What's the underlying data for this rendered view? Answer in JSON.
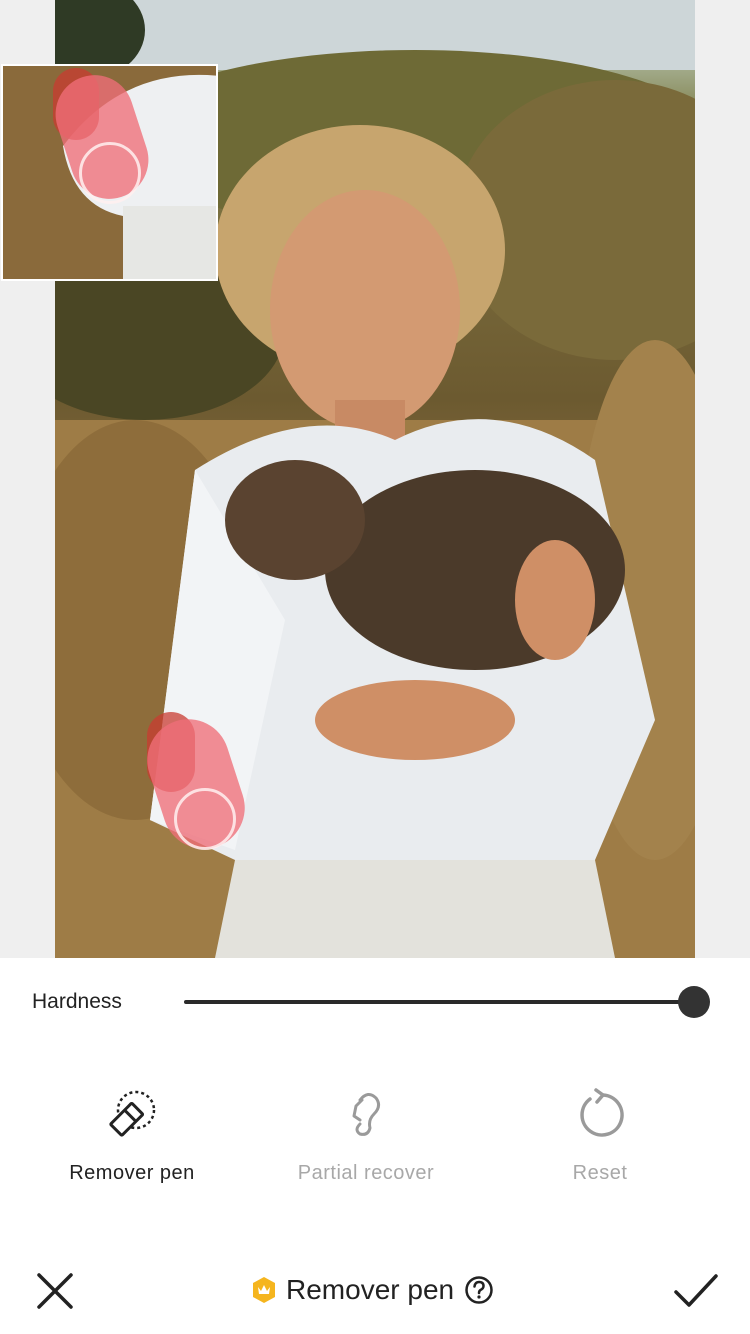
{
  "editor": {
    "hardness_label": "Hardness",
    "hardness_value": 1.0
  },
  "tools": [
    {
      "label": "Remover pen",
      "icon": "remover-pen-icon",
      "active": true
    },
    {
      "label": "Partial recover",
      "icon": "partial-recover-icon",
      "active": false
    },
    {
      "label": "Reset",
      "icon": "reset-icon",
      "active": false
    }
  ],
  "bottom_bar": {
    "title": "Remover pen",
    "premium_icon": "crown-icon",
    "help_icon": "help-icon",
    "close_icon": "close-icon",
    "confirm_icon": "checkmark-icon"
  },
  "colors": {
    "brush_highlight": "#f06e78",
    "premium_badge": "#f5b51e",
    "active_text": "#222222",
    "inactive_text": "#a8a8a8"
  }
}
